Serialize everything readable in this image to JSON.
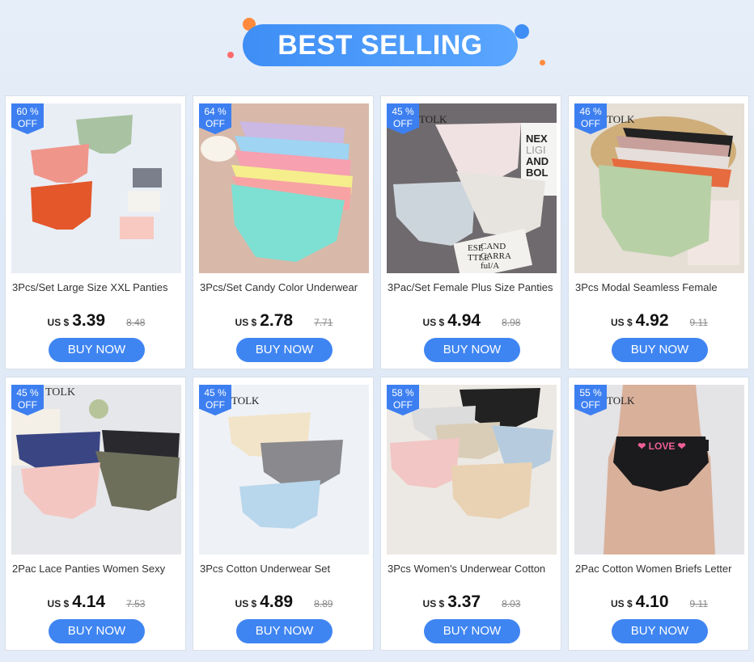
{
  "banner": {
    "title": "BEST SELLING"
  },
  "colors": {
    "accent": "#3f85f2",
    "badge": "#3d7ff0"
  },
  "buy_label": "BUY NOW",
  "currency": "US $",
  "products": [
    {
      "discount_pct": "60 %",
      "off": "OFF",
      "title": "3Pcs/Set Large Size XXL Panties",
      "price": "3.39",
      "old_price": "8.48"
    },
    {
      "discount_pct": "64 %",
      "off": "OFF",
      "title": "3Pcs/Set Candy Color Underwear",
      "price": "2.78",
      "old_price": "7.71"
    },
    {
      "discount_pct": "45 %",
      "off": "OFF",
      "title": "3Pac/Set Female Plus Size Panties",
      "price": "4.94",
      "old_price": "8.98"
    },
    {
      "discount_pct": "46 %",
      "off": "OFF",
      "title": "3Pcs Modal Seamless Female",
      "price": "4.92",
      "old_price": "9.11"
    },
    {
      "discount_pct": "45 %",
      "off": "OFF",
      "title": "2Pac Lace Panties Women Sexy",
      "price": "4.14",
      "old_price": "7.53"
    },
    {
      "discount_pct": "45 %",
      "off": "OFF",
      "title": "3Pcs Cotton Underwear Set",
      "price": "4.89",
      "old_price": "8.89"
    },
    {
      "discount_pct": "58 %",
      "off": "OFF",
      "title": "3Pcs Women's Underwear Cotton",
      "price": "3.37",
      "old_price": "8.03"
    },
    {
      "discount_pct": "55 %",
      "off": "OFF",
      "title": "2Pac Cotton Women Briefs Letter",
      "price": "4.10",
      "old_price": "9.11"
    }
  ],
  "image_text": {
    "brand": "TOLK",
    "sign_lines": [
      "NEX",
      "LIGI",
      "AND",
      "BOL"
    ],
    "note_lines": [
      "ESE",
      "TTLE",
      "CAND",
      "CARRA",
      "ful/A"
    ],
    "love": "❤ LOVE ❤"
  }
}
